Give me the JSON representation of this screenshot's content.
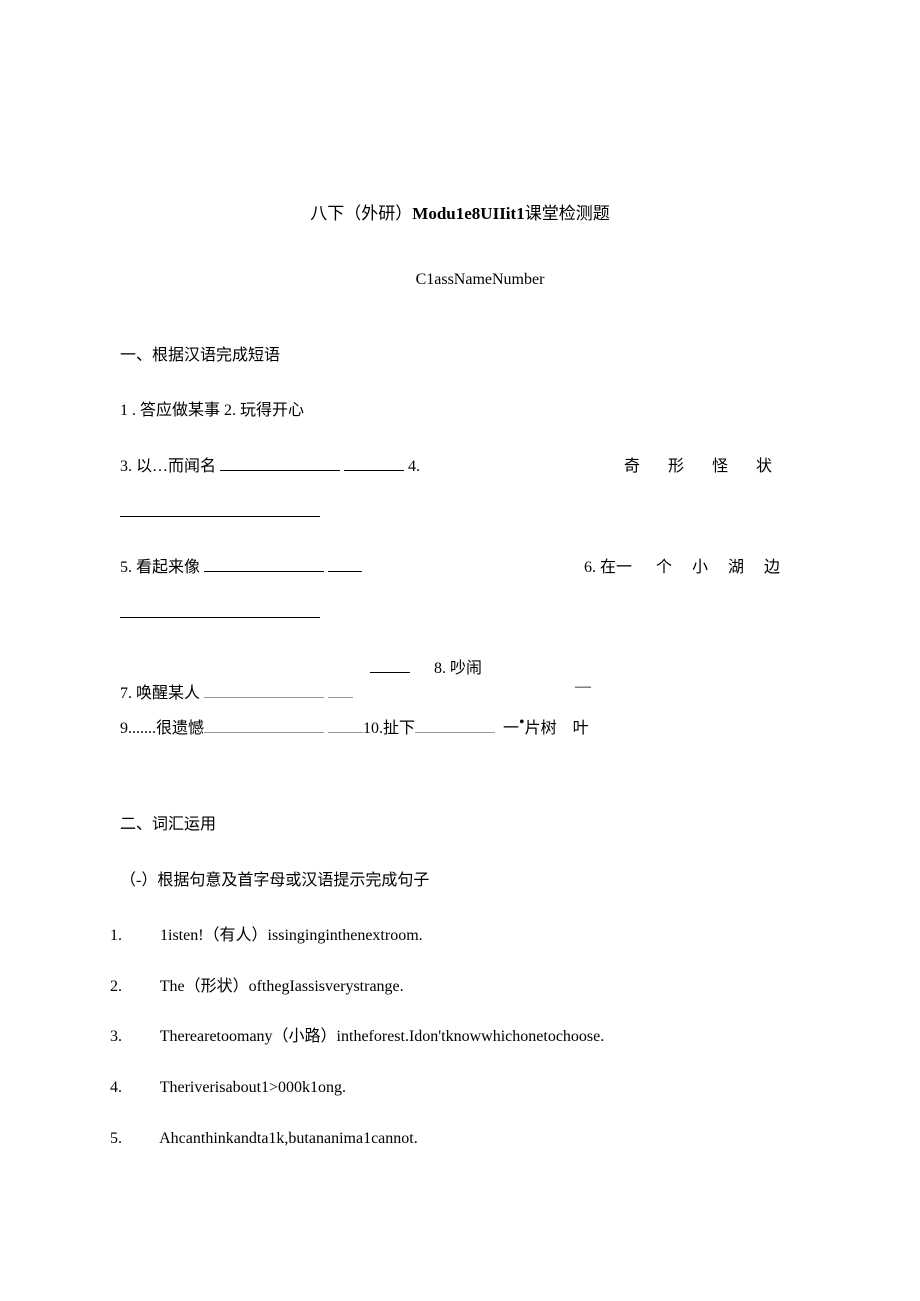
{
  "header": {
    "title_prefix": "八下（外研）",
    "title_bold": "Modu1e8UIIit1",
    "title_suffix": "课堂检测题",
    "classline": "C1assNameNumber"
  },
  "section1": {
    "header": "一、根据汉语完成短语",
    "items": {
      "q1": "1 . 答应做某事 2. 玩得开心",
      "q3_label": "3. 以…而闻名",
      "q3_num2": "4.",
      "q4_text": "奇形怪状",
      "q5_label": "5. 看起来像",
      "q6_label": "6. 在一",
      "q6_text": "个小湖边",
      "q7_label": "7. 唤醒某人",
      "q8_label": "8. 吵闹",
      "q9_label": "9.......很遗憾",
      "q10_label": "10.扯下",
      "q10_text_a": "一",
      "q10_text_b": "片树",
      "q10_text_c": "叶"
    }
  },
  "section2": {
    "header": "二、词汇运用",
    "subheader": "（-）根据句意及首字母或汉语提示完成句子",
    "items": {
      "q1": "1isten!（有人）issinginginthenextroom.",
      "q2": "The（形状）ofthegIassisverystrange.",
      "q3": "Therearetoomany（小路）intheforest.Idon'tknowwhichonetochoose.",
      "q4": "Theriverisabout1>000k1ong.",
      "q5": "Ahcanthinkandta1k,butananima1cannot."
    }
  }
}
